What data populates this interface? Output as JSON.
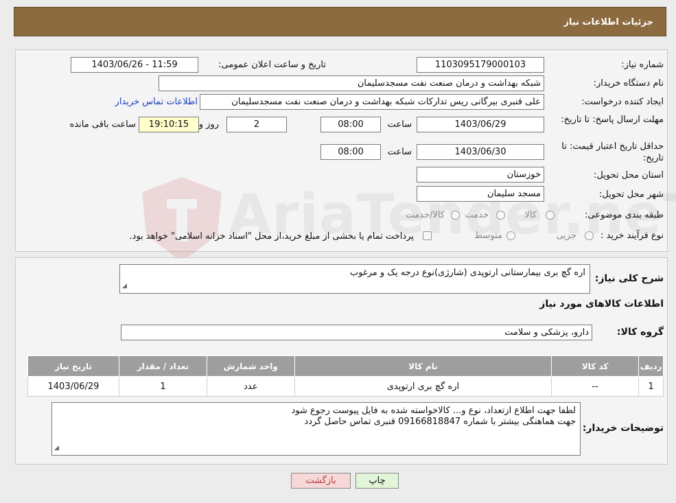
{
  "header": {
    "title": "جزئیات اطلاعات نیاز"
  },
  "details": {
    "need_number_label": "شماره نیاز:",
    "need_number": "1103095179000103",
    "announce_label": "تاریخ و ساعت اعلان عمومی:",
    "announce_value": "1403/06/26 - 11:59",
    "buyer_org_label": "نام دستگاه خریدار:",
    "buyer_org": "شبکه بهداشت و درمان صنعت نفت مسجدسلیمان",
    "creator_label": "ایجاد کننده درخواست:",
    "creator": "علی قنبری بیرگانی ریس تدارکات شبکه بهداشت و درمان صنعت نفت مسجدسلیمان",
    "contact_link": "اطلاعات تماس خریدار",
    "reply_deadline_label": "مهلت ارسال پاسخ: تا تاریخ:",
    "reply_date": "1403/06/29",
    "time_label": "ساعت",
    "reply_time": "08:00",
    "days_value": "2",
    "days_label": "روز و",
    "remaining_time": "19:10:15",
    "remaining_label": "ساعت باقی مانده",
    "price_validity_label": "حداقل تاریخ اعتبار قیمت: تا تاریخ:",
    "price_date": "1403/06/30",
    "price_time": "08:00",
    "province_label": "استان محل تحویل:",
    "province": "خوزستان",
    "city_label": "شهر محل تحویل:",
    "city": "مسجد سلیمان",
    "category_label": "طبقه بندی موضوعی:",
    "category_options": [
      "کالا",
      "خدمت",
      "کالا/خدمت"
    ],
    "process_label": "نوع فرآیند خرید :",
    "process_options": [
      "جزیی",
      "متوسط"
    ],
    "payment_note": "پرداخت تمام یا بخشی از مبلغ خرید،از محل \"اسناد خزانه اسلامی\" خواهد بود."
  },
  "description": {
    "label": "شرح کلی نیاز:",
    "value": "اره گچ بری بیمارستانی ارتوپدی (شارژی)نوع درجه یک و مرغوب"
  },
  "goods": {
    "section_title": "اطلاعات کالاهای مورد نیاز",
    "group_label": "گروه کالا:",
    "group_value": "دارو، پزشکی و سلامت",
    "columns": [
      "ردیف",
      "کد کالا",
      "نام کالا",
      "واحد شمارش",
      "تعداد / مقدار",
      "تاریخ نیاز"
    ],
    "rows": [
      [
        "1",
        "--",
        "اره گچ بری ارتوپدی",
        "عدد",
        "1",
        "1403/06/29"
      ]
    ]
  },
  "buyer_notes": {
    "label": "توضیحات خریدار:",
    "line1": "لطفا جهت اطلاع ازتعداد، نوع و... کالاخواسته شده به فایل پیوست رجوع شود",
    "line2": "جهت هماهنگی بیشتر با شماره 09166818847 قنبری تماس حاصل گردد"
  },
  "buttons": {
    "print": "چاپ",
    "back": "بازگشت"
  },
  "watermark": "AriaTender.neT",
  "colors": {
    "header_bg": "#8b6b3f",
    "link": "#1a3fc4",
    "table_header": "#9e9e9e"
  }
}
